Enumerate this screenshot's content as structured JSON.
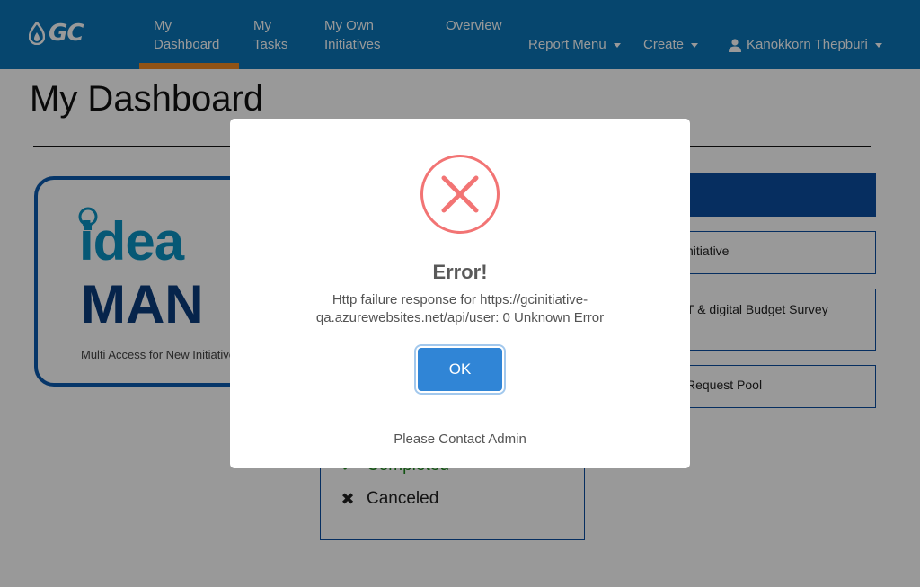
{
  "navbar": {
    "logo_text": "GC",
    "items": [
      {
        "label": "My\nDashboard"
      },
      {
        "label": "My\nTasks"
      },
      {
        "label": "My Own\nInitiatives"
      },
      {
        "label": "Overview"
      },
      {
        "label": "Report Menu"
      },
      {
        "label": "Create"
      }
    ],
    "user_name": "Kanokkorn Thepburi",
    "accent_color": "#f08a24",
    "bg_color": "#0a76b8"
  },
  "page": {
    "title": "My Dashboard"
  },
  "brand": {
    "idea": "idea",
    "man": "MAN",
    "subtitle": "Multi Access for New Initiative"
  },
  "right_panel": {
    "items": [
      {
        "label": "nitiative"
      },
      {
        "label": "T & digital Budget Survey"
      },
      {
        "label": "Request Pool"
      }
    ]
  },
  "status_list": {
    "items": [
      {
        "label": "Completed",
        "icon": "check-icon"
      },
      {
        "label": "Canceled",
        "icon": "x-icon"
      }
    ]
  },
  "modal": {
    "title": "Error!",
    "message": "Http failure response for https://gcinitiative-qa.azurewebsites.net/api/user: 0 Unknown Error",
    "ok_label": "OK",
    "footer": "Please Contact Admin",
    "icon": "error-x-icon",
    "button_color": "#3085d6",
    "icon_color": "#f27474"
  }
}
